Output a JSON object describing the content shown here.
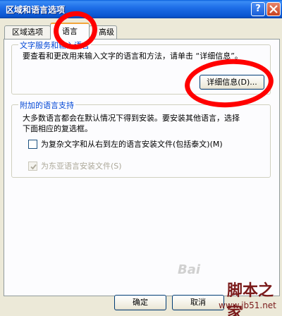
{
  "window": {
    "title": "区域和语言选项",
    "help_label": "?"
  },
  "tabs": [
    {
      "label": "区域选项"
    },
    {
      "label": "语言"
    },
    {
      "label": "高级"
    }
  ],
  "group1": {
    "legend": "文字服务和输入语言",
    "text": "要查看和更改用来输入文字的语言和方法，请单击 “详细信息”。",
    "details_button": "详细信息(D)..."
  },
  "group2": {
    "legend": "附加的语言支持",
    "text_line1": "大多数语言都会在默认情况下得到安装。要安装其他语言，选择",
    "text_line2": "下面相应的复选框。",
    "checkbox1_label": "为复杂文字和从右到左的语言安装文件(包括泰文)(M)",
    "checkbox2_label": "为东亚语言安装文件(S)"
  },
  "footer": {
    "ok_label": "确定",
    "cancel_label": "取消"
  },
  "watermark": {
    "logo": "Bai",
    "cn_text": "脚本之家",
    "url": "www.jb51.net"
  },
  "colors": {
    "title_bar": "#0a55d0",
    "legend_text": "#0046d5",
    "highlight": "#ff0000",
    "active_tab_accent": "#f2a53a"
  }
}
